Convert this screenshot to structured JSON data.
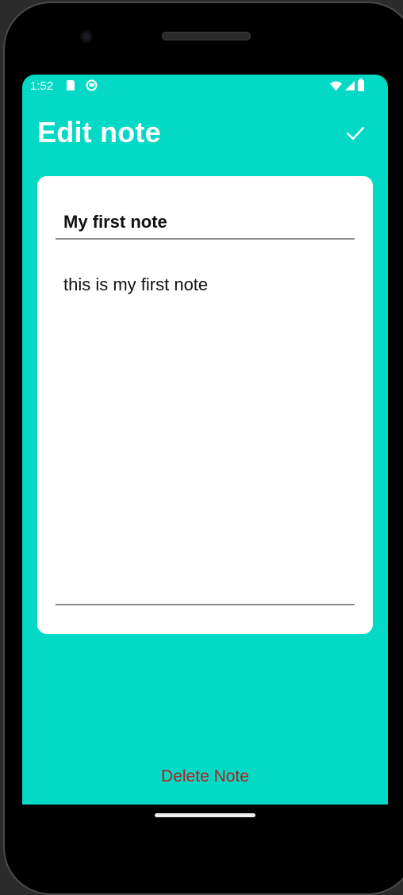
{
  "status_bar": {
    "time": "1:52",
    "icons": [
      "sd-card-icon",
      "mask-icon",
      "wifi-icon",
      "signal-icon",
      "battery-icon"
    ]
  },
  "app_bar": {
    "title": "Edit note",
    "confirm_icon": "check-icon"
  },
  "note": {
    "title": "My first note",
    "body": "this is my first note"
  },
  "actions": {
    "delete_label": "Delete Note"
  },
  "colors": {
    "background": "#03d9c5",
    "card": "#ffffff",
    "delete": "#b91c1c"
  }
}
